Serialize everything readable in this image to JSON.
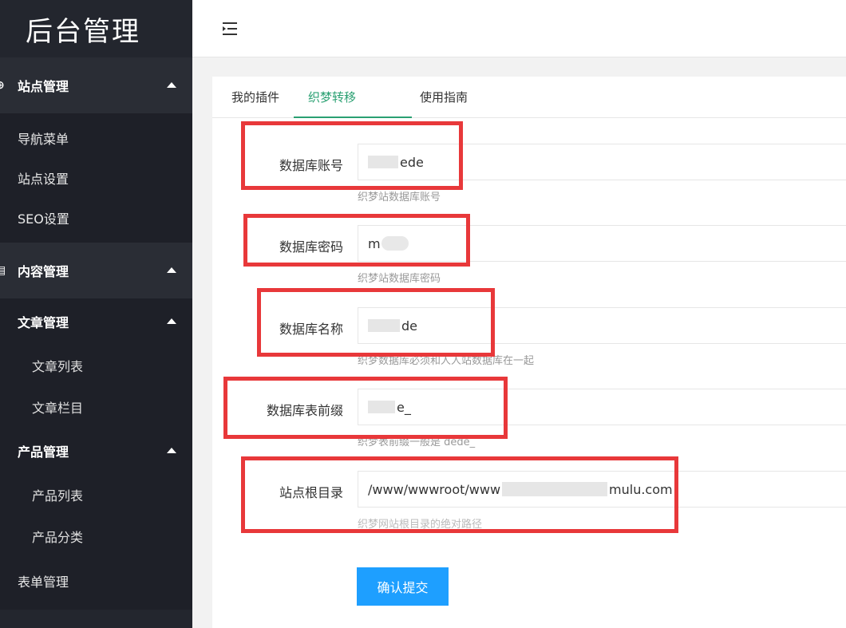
{
  "app": {
    "title": "后台管理"
  },
  "sidebar": {
    "groups": [
      {
        "label": "站点管理",
        "icon": "globe-icon",
        "items": [
          "导航菜单",
          "站点设置",
          "SEO设置"
        ]
      },
      {
        "label": "内容管理",
        "icon": "document-icon"
      }
    ],
    "content_sections": [
      {
        "label": "文章管理",
        "items": [
          "文章列表",
          "文章栏目"
        ]
      },
      {
        "label": "产品管理",
        "items": [
          "产品列表",
          "产品分类"
        ]
      }
    ],
    "form_manage": "表单管理"
  },
  "header": {
    "toggle_icon": "menu-fold-icon"
  },
  "tabs": [
    "我的插件",
    "织梦转移",
    "使用指南"
  ],
  "form": {
    "fields": [
      {
        "label": "数据库账号",
        "value": "ede",
        "hint": "织梦站数据库账号"
      },
      {
        "label": "数据库密码",
        "value": "m",
        "hint": "织梦站数据库密码"
      },
      {
        "label": "数据库名称",
        "value": "de",
        "hint": "织梦数据库必须和人人站数据库在一起"
      },
      {
        "label": "数据库表前缀",
        "value": "e_",
        "hint": "织梦表前缀一般是 dede_"
      },
      {
        "label": "站点根目录",
        "value": "/www/wwwroot/www",
        "value_tail": "mulu.com",
        "hint": "织梦网站根目录的绝对路径"
      }
    ],
    "submit_label": "确认提交"
  },
  "colors": {
    "sidebar": "#23262e",
    "accent": "#2aa072",
    "button": "#1e9fff",
    "annotation": "#e8383a"
  }
}
